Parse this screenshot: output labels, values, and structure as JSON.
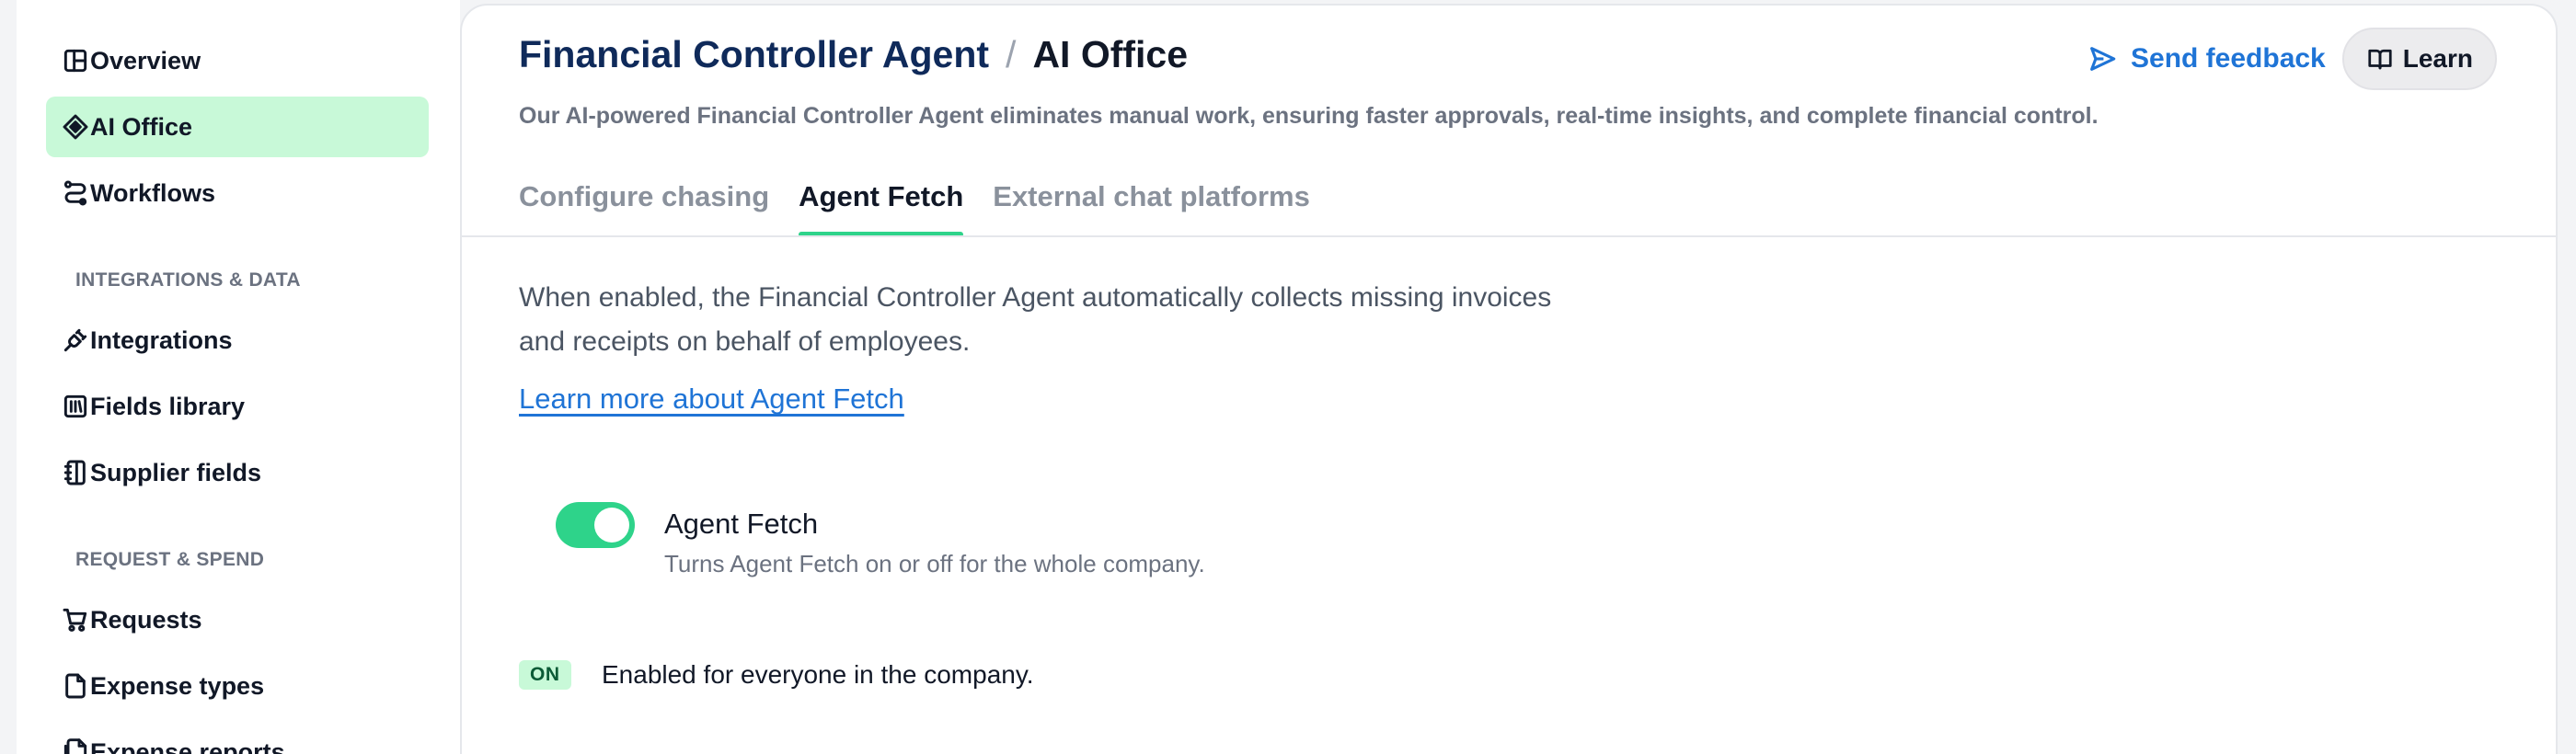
{
  "sidebar": {
    "items_top": [
      {
        "label": "Overview",
        "icon": "layout-grid-icon",
        "active": false
      },
      {
        "label": "AI Office",
        "icon": "sparkle-diamond-icon",
        "active": true
      },
      {
        "label": "Workflows",
        "icon": "workflow-icon",
        "active": false
      }
    ],
    "sections": [
      {
        "label": "INTEGRATIONS & DATA",
        "items": [
          {
            "label": "Integrations",
            "icon": "plug-icon"
          },
          {
            "label": "Fields library",
            "icon": "library-icon"
          },
          {
            "label": "Supplier fields",
            "icon": "notebook-icon"
          }
        ]
      },
      {
        "label": "REQUEST & SPEND",
        "items": [
          {
            "label": "Requests",
            "icon": "cart-icon"
          },
          {
            "label": "Expense types",
            "icon": "file-icon"
          },
          {
            "label": "Expense reports",
            "icon": "files-icon"
          }
        ]
      }
    ]
  },
  "header": {
    "breadcrumb_parent": "Financial Controller Agent",
    "breadcrumb_separator": "/",
    "breadcrumb_current": "AI Office",
    "subtitle": "Our AI-powered Financial Controller Agent eliminates manual work, ensuring faster approvals, real-time insights, and complete financial control.",
    "feedback_label": "Send feedback",
    "learn_label": "Learn"
  },
  "tabs": [
    {
      "label": "Configure chasing",
      "active": false
    },
    {
      "label": "Agent Fetch",
      "active": true
    },
    {
      "label": "External chat platforms",
      "active": false
    }
  ],
  "content": {
    "description_line1": "When enabled, the Financial Controller Agent automatically collects missing invoices",
    "description_line2": "and receipts on behalf of employees.",
    "learn_more_link": "Learn more about Agent Fetch",
    "toggle": {
      "title": "Agent Fetch",
      "description": "Turns Agent Fetch on or off for the whole company.",
      "enabled": true
    },
    "status": {
      "badge": "ON",
      "text": "Enabled for everyone in the company."
    }
  },
  "colors": {
    "accent_green": "#2ed38a",
    "active_bg": "#c8f9d8",
    "link_blue": "#1f74d6",
    "title_navy": "#0f2a5a"
  }
}
